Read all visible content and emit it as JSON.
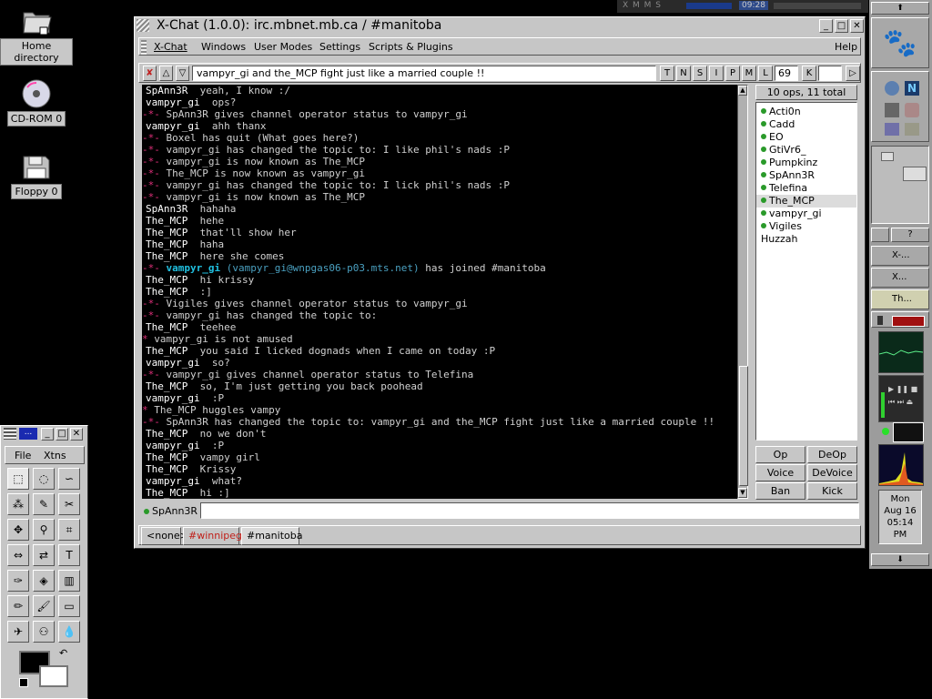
{
  "desktop": {
    "icons": [
      {
        "label": "Home directory",
        "icon": "folder-icon"
      },
      {
        "label": "CD-ROM 0",
        "icon": "cdrom-icon"
      },
      {
        "label": "Floppy 0",
        "icon": "floppy-icon"
      }
    ]
  },
  "topstrip": {
    "xmms_label": "X M M S",
    "time": "09:28"
  },
  "window": {
    "title": "X-Chat (1.0.0): irc.mbnet.mb.ca / #manitoba",
    "buttons": {
      "minimize": "_",
      "maximize": "□",
      "close": "✕"
    }
  },
  "menu": {
    "items": [
      "X-Chat",
      "Windows",
      "User Modes",
      "Settings",
      "Scripts & Plugins"
    ],
    "help": "Help"
  },
  "topicbar": {
    "topic": "vampyr_gi and the_MCP fight just like a married couple !!",
    "mode_buttons": [
      "T",
      "N",
      "S",
      "I",
      "P",
      "M",
      "L"
    ],
    "limit": "69",
    "key_button": "K",
    "key_value": ""
  },
  "chat": {
    "lines": [
      {
        "nick": "SpAnn3R",
        "msg": "yeah, I know :/",
        "type": "msg"
      },
      {
        "nick": "vampyr_gi",
        "msg": "ops?",
        "type": "msg"
      },
      {
        "text": "SpAnn3R gives channel operator status to vampyr_gi",
        "type": "event"
      },
      {
        "nick": "vampyr_gi",
        "msg": "ahh thanx",
        "type": "msg"
      },
      {
        "text": "Boxel has quit (What goes here?)",
        "type": "event"
      },
      {
        "text": "vampyr_gi has changed the topic to: I like phil's nads :P",
        "type": "event"
      },
      {
        "text": "vampyr_gi is now known as The_MCP",
        "type": "event"
      },
      {
        "text": "The_MCP is now known as vampyr_gi",
        "type": "event"
      },
      {
        "text": "vampyr_gi has changed the topic to: I lick phil's nads :P",
        "type": "event"
      },
      {
        "text": "vampyr_gi is now known as The_MCP",
        "type": "event"
      },
      {
        "nick": "SpAnn3R",
        "msg": "hahaha",
        "type": "msg"
      },
      {
        "nick": "The_MCP",
        "msg": "hehe",
        "type": "msg"
      },
      {
        "nick": "The_MCP",
        "msg": "that'll show her",
        "type": "msg"
      },
      {
        "nick": "The_MCP",
        "msg": "haha",
        "type": "msg"
      },
      {
        "nick": "The_MCP",
        "msg": "here she comes",
        "type": "msg"
      },
      {
        "nick": "vampyr_gi",
        "host": "(vampyr_gi@wnpgas06-p03.mts.net)",
        "msg": "has joined #manitoba",
        "type": "join"
      },
      {
        "nick": "The_MCP",
        "msg": "hi krissy",
        "type": "msg"
      },
      {
        "nick": "The_MCP",
        "msg": ":]",
        "type": "msg"
      },
      {
        "text": "Vigiles gives channel operator status to vampyr_gi",
        "type": "event"
      },
      {
        "text": "vampyr_gi has changed the topic to:",
        "type": "event"
      },
      {
        "nick": "The_MCP",
        "msg": "teehee",
        "type": "msg"
      },
      {
        "text": "vampyr_gi is not amused",
        "type": "action"
      },
      {
        "nick": "The_MCP",
        "msg": "you said I licked dognads when I came on today :P",
        "type": "msg"
      },
      {
        "nick": "vampyr_gi",
        "msg": "so?",
        "type": "msg"
      },
      {
        "text": "vampyr_gi gives channel operator status to Telefina",
        "type": "event"
      },
      {
        "nick": "The_MCP",
        "msg": "so, I'm just getting you back poohead",
        "type": "msg"
      },
      {
        "nick": "vampyr_gi",
        "msg": ":P",
        "type": "msg"
      },
      {
        "text": "The_MCP huggles vampy",
        "type": "action"
      },
      {
        "text": "SpAnn3R has changed the topic to: vampyr_gi and the_MCP fight just like a married couple !!",
        "type": "event"
      },
      {
        "nick": "The_MCP",
        "msg": "no we don't",
        "type": "msg"
      },
      {
        "nick": "vampyr_gi",
        "msg": ":P",
        "type": "msg"
      },
      {
        "nick": "The_MCP",
        "msg": "vampy girl",
        "type": "msg"
      },
      {
        "nick": "The_MCP",
        "msg": "Krissy",
        "type": "msg"
      },
      {
        "nick": "vampyr_gi",
        "msg": "what?",
        "type": "msg"
      },
      {
        "nick": "The_MCP",
        "msg": "hi :]",
        "type": "msg"
      }
    ]
  },
  "users": {
    "count_label": "10 ops, 11 total",
    "list": [
      {
        "name": "Acti0n",
        "op": true
      },
      {
        "name": "Cadd",
        "op": true
      },
      {
        "name": "EO",
        "op": true
      },
      {
        "name": "GtiVr6_",
        "op": true
      },
      {
        "name": "Pumpkinz",
        "op": true
      },
      {
        "name": "SpAnn3R",
        "op": true
      },
      {
        "name": "Telefina",
        "op": true
      },
      {
        "name": "The_MCP",
        "op": true,
        "selected": true
      },
      {
        "name": "vampyr_gi",
        "op": true
      },
      {
        "name": "Vigiles",
        "op": true
      },
      {
        "name": "Huzzah",
        "op": false
      }
    ],
    "buttons": [
      "Op",
      "DeOp",
      "Voice",
      "DeVoice",
      "Ban",
      "Kick"
    ]
  },
  "input": {
    "nick": "SpAnn3R",
    "value": ""
  },
  "tabs": [
    {
      "label": "<none>",
      "color": "#000000"
    },
    {
      "label": "#winnipeg",
      "color": "#c0201a"
    },
    {
      "label": "#manitoba",
      "color": "#000000",
      "active": true
    }
  ],
  "gimp": {
    "menu": [
      "File",
      "Xtns"
    ],
    "tools": [
      "rect-select-icon",
      "ellipse-select-icon",
      "lasso-icon",
      "magic-wand-icon",
      "bezier-icon",
      "scissors-icon",
      "move-icon",
      "magnify-icon",
      "crop-icon",
      "transform-icon",
      "flip-icon",
      "text-icon",
      "color-picker-icon",
      "bucket-fill-icon",
      "blend-icon",
      "pencil-icon",
      "paintbrush-icon",
      "eraser-icon",
      "airbrush-icon",
      "clone-icon",
      "convolve-icon"
    ],
    "tool_glyphs": [
      "⬚",
      "◌",
      "∽",
      "⁂",
      "✎",
      "✂",
      "✥",
      "⚲",
      "⌗",
      "⇔",
      "⇄",
      "T",
      "✑",
      "◈",
      "▥",
      "✏",
      "🖌",
      "▭",
      "✈",
      "⚇",
      "💧"
    ]
  },
  "dock": {
    "tasks": [
      "X-...",
      "X...",
      "Th..."
    ],
    "clock": {
      "day": "Mon",
      "date": "Aug 16",
      "time": "05:14",
      "ampm": "PM"
    },
    "help_button": "?"
  },
  "colors": {
    "chat_bg": "#000000",
    "event_marker": "#e0307a",
    "join_nick": "#20c0e0",
    "op_dot": "#2a9a2a"
  }
}
